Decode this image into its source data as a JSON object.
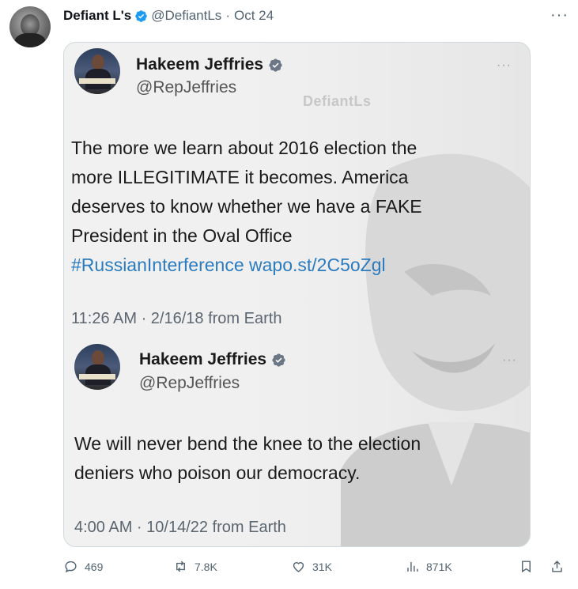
{
  "post": {
    "author_name": "Defiant L's",
    "handle": "@DefiantLs",
    "separator": "·",
    "date": "Oct 24",
    "more": "···"
  },
  "image": {
    "watermark": "DefiantLs",
    "tweet1": {
      "name": "Hakeem Jeffries",
      "handle": "@RepJeffries",
      "more": "···",
      "line1": "The more we learn about 2016 election the",
      "line2": "more ILLEGITIMATE it becomes. America",
      "line3": "deserves to know whether we have a FAKE",
      "line4": "President in the Oval Office",
      "hashtag": "#RussianInterference",
      "link": "wapo.st/2C5oZgl",
      "timestamp": "11:26 AM · 2/16/18 from Earth"
    },
    "tweet2": {
      "name": "Hakeem Jeffries",
      "handle": "@RepJeffries",
      "more": "···",
      "line1": "We will never bend the knee to the election",
      "line2": "deniers who poison our democracy.",
      "timestamp": "4:00 AM · 10/14/22 from Earth"
    }
  },
  "actions": {
    "replies": "469",
    "reposts": "7.8K",
    "likes": "31K",
    "views": "871K"
  },
  "colors": {
    "verified": "#1d9bf0",
    "link": "#2a7bbf",
    "muted": "#536471"
  }
}
